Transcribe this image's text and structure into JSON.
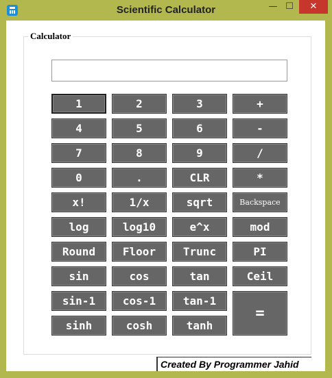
{
  "window": {
    "title": "Scientific Calculator",
    "controls": {
      "minimize": "—",
      "maximize": "☐",
      "close": "✕"
    }
  },
  "group": {
    "label": "Calculator"
  },
  "display": {
    "value": ""
  },
  "buttons": {
    "b1": "1",
    "b2": "2",
    "b3": "3",
    "plus": "+",
    "b4": "4",
    "b5": "5",
    "b6": "6",
    "minus": "-",
    "b7": "7",
    "b8": "8",
    "b9": "9",
    "divide": "/",
    "b0": "0",
    "dot": ".",
    "clr": "CLR",
    "multiply": "*",
    "fact": "x!",
    "recip": "1/x",
    "sqrt": "sqrt",
    "backspace": "Backspace",
    "log": "log",
    "log10": "log10",
    "exp": "e^x",
    "mod": "mod",
    "round": "Round",
    "floor": "Floor",
    "trunc": "Trunc",
    "pi": "PI",
    "sin": "sin",
    "cos": "cos",
    "tan": "tan",
    "ceil": "Ceil",
    "asin": "sin-1",
    "acos": "cos-1",
    "atan": "tan-1",
    "equals": "=",
    "sinh": "sinh",
    "cosh": "cosh",
    "tanh": "tanh"
  },
  "footer": {
    "credit": "Created By Programmer Jahid"
  },
  "colors": {
    "frame": "#b3b84e",
    "button": "#666666",
    "close": "#c7362d"
  }
}
